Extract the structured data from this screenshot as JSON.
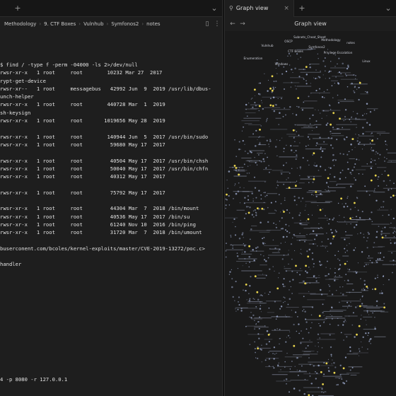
{
  "left_tabs": {
    "new_tab_icon": "plus-icon",
    "menu_icon": "chevron-down-icon"
  },
  "right_tabs": {
    "active_tab_label": "Graph view",
    "close": "×",
    "new_tab_icon": "plus-icon",
    "menu_icon": "chevron-down-icon"
  },
  "breadcrumb": [
    "Methodology",
    "9. CTF Boxes",
    "Vulnhub",
    "Symfonos2",
    "notes"
  ],
  "graph_header": {
    "title": "Graph view"
  },
  "terminal_lines": [
    "$ find / -type f -perm -04000 -ls 2>/dev/null",
    "rwsr-xr-x   1 root     root        10232 Mar 27  2017",
    "rypt-get-device",
    "rwsr-xr--   1 root     messagebus   42992 Jun  9  2019 /usr/lib/dbus-",
    "unch-helper",
    "rwsr-xr-x   1 root     root        440728 Mar  1  2019",
    "sh-keysign",
    "rwsr-xr-x   1 root     root       1019656 May 28  2019",
    "",
    "rwsr-xr-x   1 root     root        140944 Jun  5  2017 /usr/bin/sudo",
    "rwsr-xr-x   1 root     root         59680 May 17  2017",
    "",
    "rwsr-xr-x   1 root     root         40504 May 17  2017 /usr/bin/chsh",
    "rwsr-xr-x   1 root     root         50040 May 17  2017 /usr/bin/chfn",
    "rwsr-xr-x   1 root     root         40312 May 17  2017",
    "",
    "rwsr-xr-x   1 root     root         75792 May 17  2017",
    "",
    "rwsr-xr-x   1 root     root         44304 Mar  7  2018 /bin/mount",
    "rwsr-xr-x   1 root     root         40536 May 17  2017 /bin/su",
    "rwsr-xr-x   1 root     root         61240 Nov 10  2016 /bin/ping",
    "rwsr-xr-x   1 root     root         31720 Mar  7  2018 /bin/umount",
    "",
    "buserconent.com/bcoles/kernel-exploits/master/CVE-2019-13272/poc.c>",
    "",
    "handler"
  ],
  "bottom_command": "4 -p 8080 -r 127.0.0.1",
  "graph_labels": [
    "Subnets_Cheat_Sheet",
    "Methodology",
    "OSCP",
    "notes",
    "Vulnhub",
    "Symfonos2",
    "CTF Boxes",
    "Privilege Escalation",
    "Enumeration",
    "Linux",
    "Windows"
  ],
  "colors": {
    "accent": "#e8d44d",
    "node": "#9aa6c8",
    "bg": "#1e1e1e"
  }
}
